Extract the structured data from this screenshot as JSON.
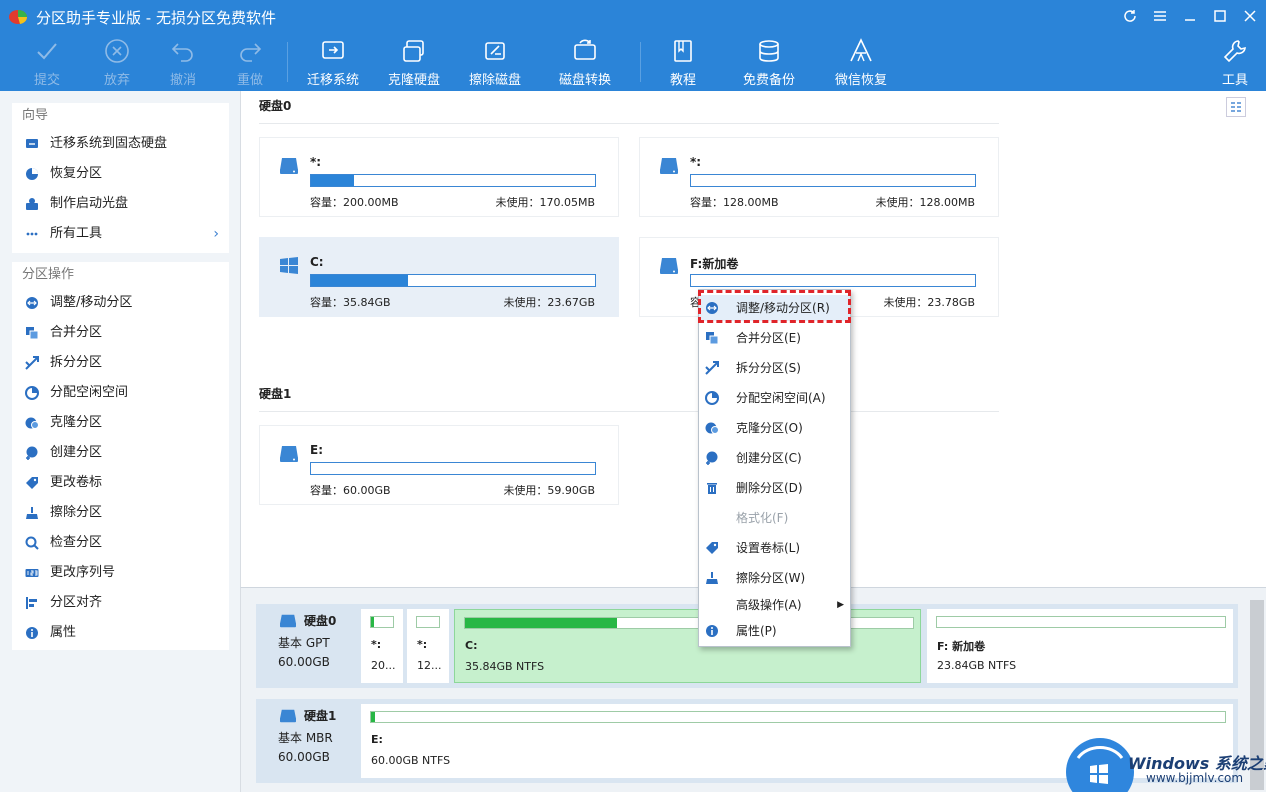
{
  "window": {
    "title": "分区助手专业版 - 无损分区免费软件"
  },
  "toolbar": {
    "commit": "提交",
    "discard": "放弃",
    "undo": "撤消",
    "redo": "重做",
    "migrate_os": "迁移系统",
    "clone_disk": "克隆硬盘",
    "wipe_disk": "擦除磁盘",
    "disk_convert": "磁盘转换",
    "tutorial": "教程",
    "free_backup": "免费备份",
    "wechat_recover": "微信恢复",
    "tools": "工具"
  },
  "sidebar": {
    "wizard_title": "向导",
    "wizard_items": [
      {
        "label": "迁移系统到固态硬盘",
        "icon": "migrate-icon"
      },
      {
        "label": "恢复分区",
        "icon": "recover-icon"
      },
      {
        "label": "制作启动光盘",
        "icon": "bootdisk-icon"
      },
      {
        "label": "所有工具",
        "icon": "more-icon"
      }
    ],
    "ops_title": "分区操作",
    "ops_items": [
      {
        "label": "调整/移动分区",
        "icon": "resize-icon"
      },
      {
        "label": "合并分区",
        "icon": "merge-icon"
      },
      {
        "label": "拆分分区",
        "icon": "split-icon"
      },
      {
        "label": "分配空闲空间",
        "icon": "allocate-icon"
      },
      {
        "label": "克隆分区",
        "icon": "clone-icon"
      },
      {
        "label": "创建分区",
        "icon": "create-icon"
      },
      {
        "label": "更改卷标",
        "icon": "label-icon"
      },
      {
        "label": "擦除分区",
        "icon": "wipe-icon"
      },
      {
        "label": "检查分区",
        "icon": "check-icon"
      },
      {
        "label": "更改序列号",
        "icon": "serial-icon"
      },
      {
        "label": "分区对齐",
        "icon": "align-icon"
      },
      {
        "label": "属性",
        "icon": "info-icon"
      }
    ]
  },
  "main": {
    "disk0_label": "硬盘0",
    "disk1_label": "硬盘1",
    "cards": [
      {
        "name": "*:",
        "capacity": "容量：200.00MB",
        "free": "未使用：170.05MB",
        "used_fraction": 0.15
      },
      {
        "name": "*:",
        "capacity": "容量：128.00MB",
        "free": "未使用：128.00MB",
        "used_fraction": 0.0
      },
      {
        "name": "C:",
        "capacity": "容量：35.84GB",
        "free": "未使用：23.67GB",
        "used_fraction": 0.34
      },
      {
        "name": "F:新加卷",
        "capacity": "容",
        "free": "未使用：23.78GB",
        "used_fraction": 0.0
      },
      {
        "name": "E:",
        "capacity": "容量：60.00GB",
        "free": "未使用：59.90GB",
        "used_fraction": 0.0
      }
    ]
  },
  "diskmap": {
    "disk0": {
      "name": "硬盘0",
      "type": "基本 GPT",
      "size": "60.00GB"
    },
    "disk1": {
      "name": "硬盘1",
      "type": "基本 MBR",
      "size": "60.00GB"
    },
    "disk0_parts": [
      {
        "name": "*:",
        "size": "20...",
        "used_fraction": 0.15
      },
      {
        "name": "*:",
        "size": "12...",
        "used_fraction": 0.0
      },
      {
        "name": "C:",
        "size": "35.84GB NTFS",
        "used_fraction": 0.34
      },
      {
        "name": "F: 新加卷",
        "size": "23.84GB NTFS",
        "used_fraction": 0.0
      }
    ],
    "disk1_parts": [
      {
        "name": "E:",
        "size": "60.00GB NTFS",
        "used_fraction": 0.0
      }
    ]
  },
  "context_menu": {
    "items": [
      {
        "label": "调整/移动分区(R)",
        "icon": "resize-icon",
        "enabled": true
      },
      {
        "label": "合并分区(E)",
        "icon": "merge-icon",
        "enabled": true
      },
      {
        "label": "拆分分区(S)",
        "icon": "split-icon",
        "enabled": true
      },
      {
        "label": "分配空闲空间(A)",
        "icon": "allocate-icon",
        "enabled": true
      },
      {
        "label": "克隆分区(O)",
        "icon": "clone-icon",
        "enabled": true
      },
      {
        "label": "创建分区(C)",
        "icon": "create-icon",
        "enabled": true
      },
      {
        "label": "删除分区(D)",
        "icon": "delete-icon",
        "enabled": true
      },
      {
        "label": "格式化(F)",
        "icon": "",
        "enabled": false
      },
      {
        "label": "设置卷标(L)",
        "icon": "label-icon",
        "enabled": true
      },
      {
        "label": "擦除分区(W)",
        "icon": "wipe-icon",
        "enabled": true
      },
      {
        "label": "高级操作(A)",
        "icon": "",
        "enabled": true,
        "submenu": true
      },
      {
        "label": "属性(P)",
        "icon": "info-icon",
        "enabled": true
      }
    ]
  },
  "watermark": {
    "title": "Windows 系统之家",
    "url": "www.bjjmlv.com"
  },
  "colors": {
    "accent": "#2b84d8",
    "used_bar": "#28b745",
    "selected_part": "#c6f0cd",
    "highlight_box": "#e0242a"
  }
}
